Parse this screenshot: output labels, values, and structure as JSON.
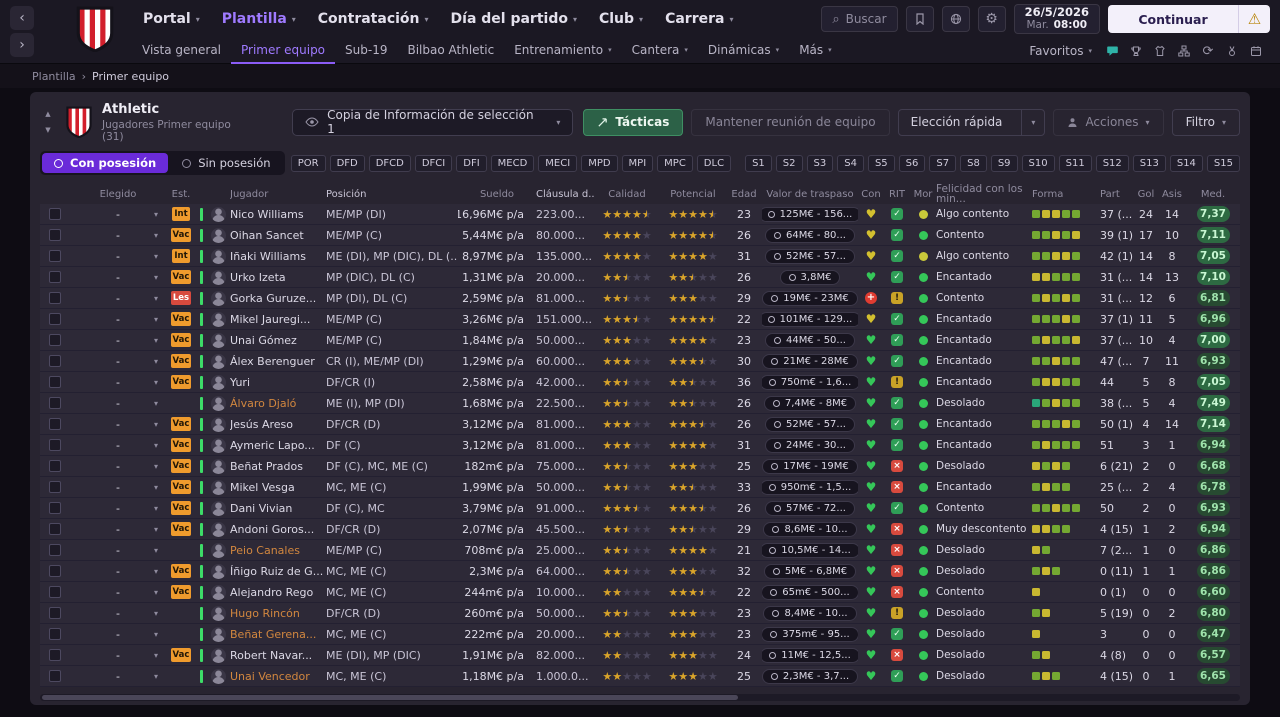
{
  "topbar": {
    "menus": [
      {
        "label": "Portal"
      },
      {
        "label": "Plantilla",
        "active": true
      },
      {
        "label": "Contratación"
      },
      {
        "label": "Día del partido"
      },
      {
        "label": "Club"
      },
      {
        "label": "Carrera"
      }
    ],
    "search_label": "Buscar",
    "date": "26/5/2026",
    "day": "Mar.",
    "time": "08:00",
    "continue_label": "Continuar"
  },
  "subnav": {
    "items": [
      {
        "label": "Vista general"
      },
      {
        "label": "Primer equipo",
        "active": true
      },
      {
        "label": "Sub-19"
      },
      {
        "label": "Bilbao Athletic"
      },
      {
        "label": "Entrenamiento",
        "caret": true
      },
      {
        "label": "Cantera",
        "caret": true
      },
      {
        "label": "Dinámicas",
        "caret": true
      },
      {
        "label": "Más",
        "caret": true
      }
    ],
    "favoritos_label": "Favoritos",
    "icons": [
      "chat",
      "trophy",
      "shirt",
      "hierarchy",
      "refresh",
      "medal",
      "calendar"
    ]
  },
  "breadcrumb": {
    "items": [
      "Plantilla",
      "Primer equipo"
    ]
  },
  "panel": {
    "club": "Athletic",
    "subtitle": "Jugadores Primer equipo (31)",
    "view_dropdown": "Copia de Información de selección 1",
    "buttons": {
      "tactics": "Tácticas",
      "meeting": "Mantener reunión de equipo",
      "quick_pick": "Elección rápida",
      "actions": "Acciones",
      "filter": "Filtro"
    }
  },
  "filters": {
    "possession_on": "Con posesión",
    "possession_off": "Sin posesión",
    "positions": [
      "POR",
      "DFD",
      "DFCD",
      "DFCI",
      "DFI",
      "MECD",
      "MECI",
      "MPD",
      "MPI",
      "MPC",
      "DLC"
    ],
    "slots": [
      "S1",
      "S2",
      "S3",
      "S4",
      "S5",
      "S6",
      "S7",
      "S8",
      "S9",
      "S10",
      "S11",
      "S12",
      "S13",
      "S14",
      "S15"
    ]
  },
  "table": {
    "columns": [
      "Elegido",
      "Est.",
      "Jugador",
      "Posición",
      "Sueldo",
      "Cláusula d...",
      "Calidad",
      "Potencial",
      "Edad",
      "Valor de traspaso",
      "Con",
      "RIT",
      "Mor",
      "Felicidad con los min...",
      "Forma",
      "Part",
      "Gol",
      "Asis",
      "Med."
    ],
    "rows": [
      {
        "sel": "-",
        "est": "Int",
        "name": "Nico Williams",
        "listed": false,
        "pos": "ME/MP (DI)",
        "wage": "16,96M€ p/a",
        "clause": "223.00...",
        "quality": 4.5,
        "potential": 4.5,
        "age": 23,
        "value": "125M€ - 156...",
        "fit": "gold",
        "sharp": "ok",
        "morale": "yellow",
        "happy": "Algo contento",
        "form": [
          "g",
          "y",
          "y",
          "g",
          "g"
        ],
        "part": "37 (...",
        "gol": 24,
        "asis": 14,
        "med": "7,37"
      },
      {
        "sel": "-",
        "est": "Vac",
        "name": "Oihan Sancet",
        "listed": false,
        "pos": "ME/MP (C)",
        "wage": "5,44M€ p/a",
        "clause": "80.000...",
        "quality": 4,
        "potential": 4.5,
        "age": 26,
        "value": "64M€ - 80...",
        "fit": "gold",
        "sharp": "ok",
        "morale": "green",
        "happy": "Contento",
        "form": [
          "g",
          "g",
          "y",
          "g",
          "y"
        ],
        "part": "39 (1)",
        "gol": 17,
        "asis": 10,
        "med": "7,11"
      },
      {
        "sel": "-",
        "est": "Int",
        "name": "Iñaki Williams",
        "listed": false,
        "pos": "ME (DI), MP (DIC), DL (...",
        "wage": "8,97M€ p/a",
        "clause": "135.000...",
        "quality": 4,
        "potential": 4,
        "age": 31,
        "value": "52M€ - 57...",
        "fit": "gold",
        "sharp": "ok",
        "morale": "yellow",
        "happy": "Algo contento",
        "form": [
          "g",
          "g",
          "y",
          "y",
          "g"
        ],
        "part": "42 (1)",
        "gol": 14,
        "asis": 8,
        "med": "7,05"
      },
      {
        "sel": "-",
        "est": "Vac",
        "name": "Urko Izeta",
        "listed": false,
        "pos": "MP (DIC), DL (C)",
        "wage": "1,31M€ p/a",
        "clause": "20.000...",
        "quality": 2.5,
        "potential": 2.5,
        "age": 26,
        "value": "3,8M€",
        "fit": "green",
        "sharp": "ok",
        "morale": "green",
        "happy": "Encantado",
        "form": [
          "y",
          "y",
          "g",
          "g",
          "g"
        ],
        "part": "31 (...",
        "gol": 14,
        "asis": 13,
        "med": "7,10"
      },
      {
        "sel": "-",
        "est": "Les",
        "name": "Gorka Guruze...",
        "listed": false,
        "pos": "MP (DI), DL (C)",
        "wage": "2,59M€ p/a",
        "clause": "81.000...",
        "quality": 2.5,
        "potential": 3,
        "age": 29,
        "value": "19M€ - 23M€",
        "fit": "injury",
        "sharp": "warn",
        "morale": "green",
        "happy": "Contento",
        "form": [
          "g",
          "y",
          "g",
          "y",
          "g"
        ],
        "part": "31 (...",
        "gol": 12,
        "asis": 6,
        "med": "6,81"
      },
      {
        "sel": "-",
        "est": "Vac",
        "name": "Mikel Jauregi...",
        "listed": false,
        "pos": "ME/MP (C)",
        "wage": "3,26M€ p/a",
        "clause": "151.000...",
        "quality": 3.5,
        "potential": 4.5,
        "age": 22,
        "value": "101M€ - 129...",
        "fit": "gold",
        "sharp": "ok",
        "morale": "green",
        "happy": "Encantado",
        "form": [
          "g",
          "g",
          "g",
          "y",
          "g"
        ],
        "part": "37 (1)",
        "gol": 11,
        "asis": 5,
        "med": "6,96"
      },
      {
        "sel": "-",
        "est": "Vac",
        "name": "Unai Gómez",
        "listed": false,
        "pos": "ME/MP (C)",
        "wage": "1,84M€ p/a",
        "clause": "50.000...",
        "quality": 3,
        "potential": 4,
        "age": 23,
        "value": "44M€ - 50...",
        "fit": "green",
        "sharp": "ok",
        "morale": "green",
        "happy": "Encantado",
        "form": [
          "g",
          "y",
          "g",
          "g",
          "y"
        ],
        "part": "37 (...",
        "gol": 10,
        "asis": 4,
        "med": "7,00"
      },
      {
        "sel": "-",
        "est": "Vac",
        "name": "Álex Berenguer",
        "listed": false,
        "pos": "CR (I), ME/MP (DI)",
        "wage": "1,29M€ p/a",
        "clause": "60.000...",
        "quality": 3,
        "potential": 3.5,
        "age": 30,
        "value": "21M€ - 28M€",
        "fit": "green",
        "sharp": "ok",
        "morale": "green",
        "happy": "Encantado",
        "form": [
          "g",
          "g",
          "y",
          "g",
          "g"
        ],
        "part": "47 (...",
        "gol": 7,
        "asis": 11,
        "med": "6,93"
      },
      {
        "sel": "-",
        "est": "Vac",
        "name": "Yuri",
        "listed": false,
        "pos": "DF/CR (I)",
        "wage": "2,58M€ p/a",
        "clause": "42.000...",
        "quality": 2.5,
        "potential": 2.5,
        "age": 36,
        "value": "750m€ - 1,6...",
        "fit": "green",
        "sharp": "warn",
        "morale": "green",
        "happy": "Encantado",
        "form": [
          "g",
          "y",
          "y",
          "g",
          "g"
        ],
        "part": "44",
        "gol": 5,
        "asis": 8,
        "med": "7,05"
      },
      {
        "sel": "-",
        "est": "",
        "name": "Álvaro Djaló",
        "listed": true,
        "pos": "ME (I), MP (DI)",
        "wage": "1,68M€ p/a",
        "clause": "22.500...",
        "quality": 2.5,
        "potential": 2.5,
        "age": 26,
        "value": "7,4M€ - 8M€",
        "fit": "green",
        "sharp": "ok",
        "morale": "green",
        "happy": "Desolado",
        "form": [
          "t",
          "g",
          "y",
          "g",
          "g"
        ],
        "part": "38 (...",
        "gol": 5,
        "asis": 4,
        "med": "7,49"
      },
      {
        "sel": "-",
        "est": "Vac",
        "name": "Jesús Areso",
        "listed": false,
        "pos": "DF/CR (D)",
        "wage": "3,12M€ p/a",
        "clause": "81.000...",
        "quality": 3,
        "potential": 3.5,
        "age": 26,
        "value": "52M€ - 57...",
        "fit": "green",
        "sharp": "ok",
        "morale": "green",
        "happy": "Encantado",
        "form": [
          "g",
          "g",
          "g",
          "y",
          "g"
        ],
        "part": "50 (1)",
        "gol": 4,
        "asis": 14,
        "med": "7,14"
      },
      {
        "sel": "-",
        "est": "Vac",
        "name": "Aymeric Lapo...",
        "listed": false,
        "pos": "DF (C)",
        "wage": "3,12M€ p/a",
        "clause": "81.000...",
        "quality": 3,
        "potential": 4,
        "age": 31,
        "value": "24M€ - 30...",
        "fit": "green",
        "sharp": "ok",
        "morale": "green",
        "happy": "Encantado",
        "form": [
          "g",
          "y",
          "g",
          "g",
          "g"
        ],
        "part": "51",
        "gol": 3,
        "asis": 1,
        "med": "6,94"
      },
      {
        "sel": "-",
        "est": "Vac",
        "name": "Beñat Prados",
        "listed": false,
        "pos": "DF (C), MC, ME (C)",
        "wage": "182m€ p/a",
        "clause": "75.000...",
        "quality": 2.5,
        "potential": 3,
        "age": 25,
        "value": "17M€ - 19M€",
        "fit": "green",
        "sharp": "low",
        "morale": "green",
        "happy": "Desolado",
        "form": [
          "y",
          "g",
          "y",
          "g"
        ],
        "part": "6 (21)",
        "gol": 2,
        "asis": 0,
        "med": "6,68"
      },
      {
        "sel": "-",
        "est": "Vac",
        "name": "Mikel Vesga",
        "listed": false,
        "pos": "MC, ME (C)",
        "wage": "1,99M€ p/a",
        "clause": "50.000...",
        "quality": 2.5,
        "potential": 2.5,
        "age": 33,
        "value": "950m€ - 1,5...",
        "fit": "green",
        "sharp": "low",
        "morale": "green",
        "happy": "Encantado",
        "form": [
          "g",
          "y",
          "g",
          "g"
        ],
        "part": "25 (...",
        "gol": 2,
        "asis": 4,
        "med": "6,78"
      },
      {
        "sel": "-",
        "est": "Vac",
        "name": "Dani Vivian",
        "listed": false,
        "pos": "DF (C), MC",
        "wage": "3,79M€ p/a",
        "clause": "91.000...",
        "quality": 3.5,
        "potential": 3.5,
        "age": 26,
        "value": "57M€ - 72...",
        "fit": "green",
        "sharp": "ok",
        "morale": "green",
        "happy": "Contento",
        "form": [
          "g",
          "g",
          "y",
          "g",
          "g"
        ],
        "part": "50",
        "gol": 2,
        "asis": 0,
        "med": "6,93"
      },
      {
        "sel": "-",
        "est": "Vac",
        "name": "Andoni Goros...",
        "listed": false,
        "pos": "DF/CR (D)",
        "wage": "2,07M€ p/a",
        "clause": "45.500...",
        "quality": 2.5,
        "potential": 2.5,
        "age": 29,
        "value": "8,6M€ - 10...",
        "fit": "green",
        "sharp": "low",
        "morale": "green",
        "happy": "Muy descontento",
        "form": [
          "y",
          "y",
          "g",
          "g"
        ],
        "part": "4 (15)",
        "gol": 1,
        "asis": 2,
        "med": "6,94"
      },
      {
        "sel": "-",
        "est": "",
        "name": "Peio Canales",
        "listed": true,
        "pos": "ME/MP (C)",
        "wage": "708m€ p/a",
        "clause": "25.000...",
        "quality": 2.5,
        "potential": 4,
        "age": 21,
        "value": "10,5M€ - 14...",
        "fit": "green",
        "sharp": "low",
        "morale": "green",
        "happy": "Desolado",
        "form": [
          "y",
          "g"
        ],
        "part": "7 (2...",
        "gol": 1,
        "asis": 0,
        "med": "6,86"
      },
      {
        "sel": "-",
        "est": "Vac",
        "name": "Íñigo Ruiz de G...",
        "listed": false,
        "pos": "MC, ME (C)",
        "wage": "2,3M€ p/a",
        "clause": "64.000...",
        "quality": 2.5,
        "potential": 3,
        "age": 32,
        "value": "5M€ - 6,8M€",
        "fit": "green",
        "sharp": "low",
        "morale": "green",
        "happy": "Desolado",
        "form": [
          "g",
          "y",
          "g"
        ],
        "part": "0 (11)",
        "gol": 1,
        "asis": 1,
        "med": "6,86"
      },
      {
        "sel": "-",
        "est": "Vac",
        "name": "Alejandro Rego",
        "listed": false,
        "pos": "MC, ME (C)",
        "wage": "244m€ p/a",
        "clause": "10.000...",
        "quality": 2,
        "potential": 3.5,
        "age": 22,
        "value": "65m€ - 500...",
        "fit": "green",
        "sharp": "low",
        "morale": "green",
        "happy": "Contento",
        "form": [
          "y"
        ],
        "part": "0 (1)",
        "gol": 0,
        "asis": 0,
        "med": "6,60"
      },
      {
        "sel": "-",
        "est": "",
        "name": "Hugo Rincón",
        "listed": true,
        "pos": "DF/CR (D)",
        "wage": "260m€ p/a",
        "clause": "50.000...",
        "quality": 2.5,
        "potential": 3,
        "age": 23,
        "value": "8,4M€ - 10...",
        "fit": "green",
        "sharp": "warn",
        "morale": "green",
        "happy": "Desolado",
        "form": [
          "g",
          "y"
        ],
        "part": "5 (19)",
        "gol": 0,
        "asis": 2,
        "med": "6,80"
      },
      {
        "sel": "-",
        "est": "",
        "name": "Beñat Gerena...",
        "listed": true,
        "pos": "MC, ME (C)",
        "wage": "222m€ p/a",
        "clause": "20.000...",
        "quality": 2,
        "potential": 3,
        "age": 23,
        "value": "375m€ - 95...",
        "fit": "green",
        "sharp": "ok",
        "morale": "green",
        "happy": "Desolado",
        "form": [
          "y"
        ],
        "part": "3",
        "gol": 0,
        "asis": 0,
        "med": "6,47"
      },
      {
        "sel": "-",
        "est": "Vac",
        "name": "Robert Navar...",
        "listed": false,
        "pos": "ME (DI), MP (DIC)",
        "wage": "1,91M€ p/a",
        "clause": "82.000...",
        "quality": 2,
        "potential": 3,
        "age": 24,
        "value": "11M€ - 12,5...",
        "fit": "green",
        "sharp": "low",
        "morale": "green",
        "happy": "Desolado",
        "form": [
          "g",
          "y"
        ],
        "part": "4 (8)",
        "gol": 0,
        "asis": 0,
        "med": "6,57"
      },
      {
        "sel": "-",
        "est": "",
        "name": "Unai Vencedor",
        "listed": true,
        "pos": "MC, ME (C)",
        "wage": "1,18M€ p/a",
        "clause": "1.000.0...",
        "quality": 2,
        "potential": 3,
        "age": 25,
        "value": "2,3M€ - 3,7...",
        "fit": "green",
        "sharp": "ok",
        "morale": "green",
        "happy": "Desolado",
        "form": [
          "g",
          "y",
          "g"
        ],
        "part": "4 (15)",
        "gol": 0,
        "asis": 1,
        "med": "6,65"
      }
    ]
  }
}
